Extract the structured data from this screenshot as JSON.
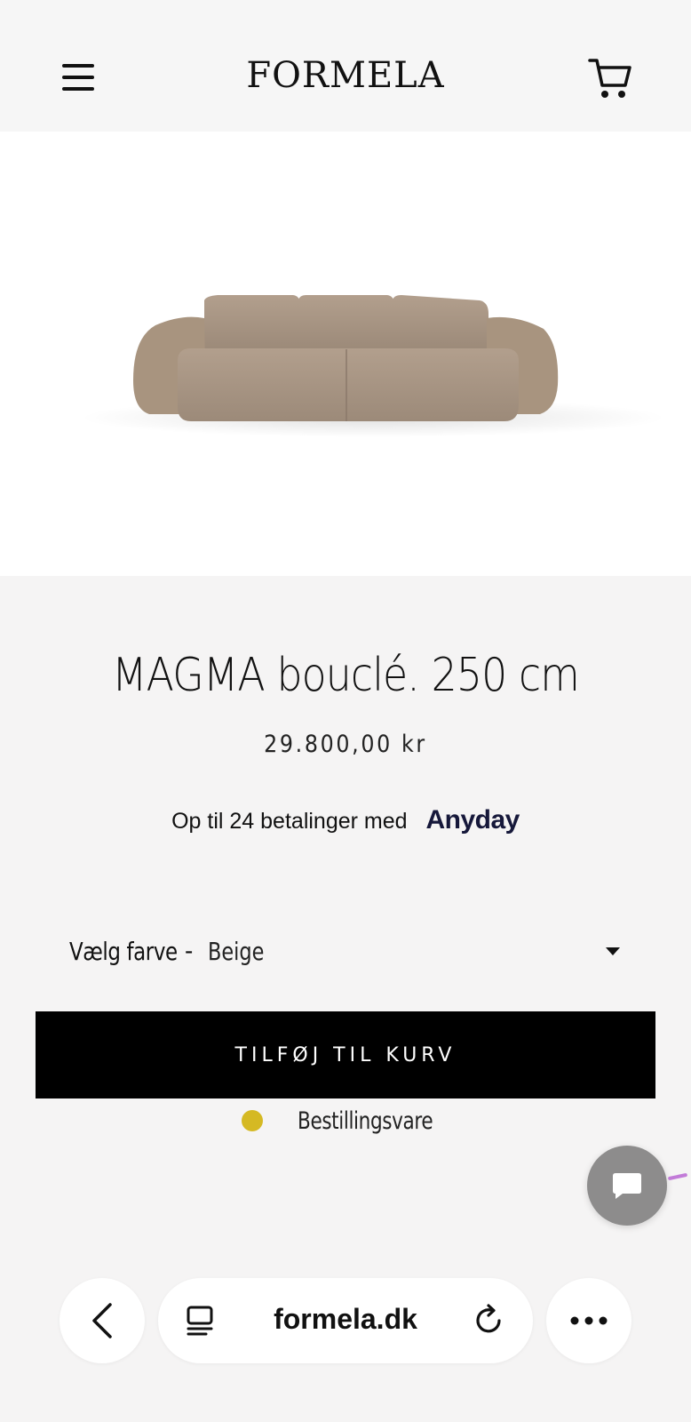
{
  "header": {
    "logo": "FORMELA",
    "menu_icon": "hamburger-menu-icon",
    "cart_icon": "shopping-cart-icon"
  },
  "product": {
    "image_alt": "sofa-product-image",
    "title": "MAGMA bouclé. 250 cm",
    "price": "29.800,00 kr",
    "financing_text": "Op til 24 betalinger med",
    "financing_brand": "Anyday",
    "color_label": "Vælg farve",
    "color_separator": "-",
    "color_value": "Beige",
    "add_to_cart": "TILFØJ TIL KURV",
    "stock_status": "Bestillingsvare",
    "stock_color": "#d5b923"
  },
  "chat": {
    "icon": "chat-bubble-icon",
    "color": "#8d8c8c"
  },
  "browser": {
    "url": "formela.dk",
    "back_icon": "chevron-left-icon",
    "tabs_icon": "tabs-icon",
    "reload_icon": "reload-icon",
    "more_icon": "more-dots-icon"
  }
}
